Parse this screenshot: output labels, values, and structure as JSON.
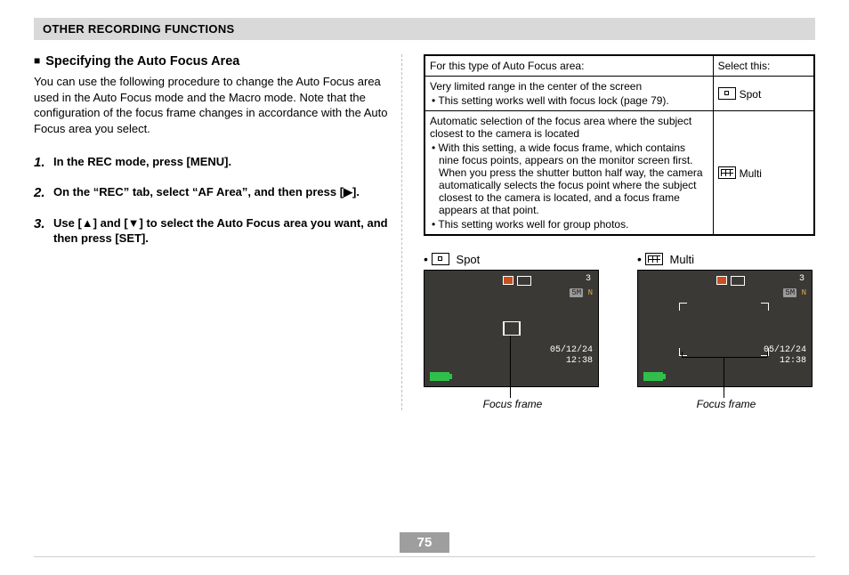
{
  "header": "OTHER RECORDING FUNCTIONS",
  "section_title": "Specifying the Auto Focus Area",
  "intro": "You can use the following procedure to change the Auto Focus area used in the Auto Focus mode and the Macro mode. Note that the configuration of the focus frame changes in accordance with the Auto Focus area you select.",
  "steps": {
    "s1_num": "1.",
    "s1": "In the REC mode, press [MENU].",
    "s2_num": "2.",
    "s2": "On the “REC” tab, select “AF Area”, and then press [▶].",
    "s3_num": "3.",
    "s3": "Use [▲] and [▼] to select the Auto Focus area you want, and then press [SET]."
  },
  "table": {
    "head_left": "For this type of Auto Focus area:",
    "head_right": "Select this:",
    "rows": [
      {
        "desc_main": "Very limited range in the center of the screen",
        "desc_bullet": "• This setting works well with focus lock (page 79).",
        "select_label": "Spot",
        "icon": "spot"
      },
      {
        "desc_main": "Automatic selection of the focus area where the subject closest to the camera is located",
        "desc_bullet": "• With this setting, a wide focus frame, which contains nine focus points, appears on the monitor screen first. When you press the shutter button half way, the camera automatically selects the focus point where the subject closest to the camera is located, and a focus frame appears at that point.",
        "desc_bullet2": "• This setting works well for group photos.",
        "select_label": "Multi",
        "icon": "multi"
      }
    ]
  },
  "previews": {
    "spot_label": "Spot",
    "multi_label": "Multi",
    "screen_num": "3",
    "screen_res_badge": "5M",
    "screen_res_n": "N",
    "screen_date": "05/12/24",
    "screen_time": "12:38",
    "caption": "Focus frame"
  },
  "page_number": "75"
}
